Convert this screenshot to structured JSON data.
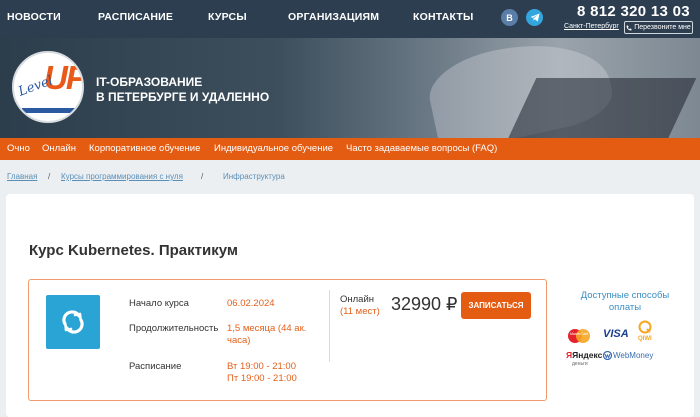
{
  "nav": {
    "items": [
      "НОВОСТИ",
      "РАСПИСАНИЕ",
      "КУРСЫ",
      "ОРГАНИЗАЦИЯМ",
      "КОНТАКТЫ"
    ],
    "vk_label": "В",
    "phone": "8 812 320 13 03",
    "city": "Санкт-Петербург",
    "callback": "Перезвоните мне"
  },
  "hero": {
    "logo_up": "UP",
    "logo_level": "Level",
    "title_line1": "IT-ОБРАЗОВАНИЕ",
    "title_line2": "В ПЕТЕРБУРГЕ И УДАЛЕННО"
  },
  "menu": {
    "items": [
      "Очно",
      "Онлайн",
      "Корпоративное обучение",
      "Индивидуальное обучение",
      "Часто задаваемые вопросы (FAQ)"
    ]
  },
  "breadcrumb": {
    "home": "Главная",
    "sep": "/",
    "courses": "Курсы программирования с нуля",
    "current": "Инфраструктура"
  },
  "course": {
    "title": "Курс Kubernetes. Практикум",
    "start_label": "Начало курса",
    "start_value": "06.02.2024",
    "duration_label": "Продолжительность",
    "duration_value": "1,5 месяца (44 ак. часа)",
    "schedule_label": "Расписание",
    "schedule_line1": "Вт 19:00 - 21:00",
    "schedule_line2": "Пт 19:00 - 21:00",
    "format_label": "Онлайн",
    "seats": "(11 мест)",
    "price": "32990 ₽",
    "enroll": "ЗАПИСАТЬСЯ"
  },
  "payment": {
    "title": "Доступные способы оплаты",
    "methods": [
      "MasterCard",
      "VISA",
      "QIWI",
      "Яндекс",
      "деньги",
      "WebMoney"
    ]
  },
  "colors": {
    "nav_bg": "#2c3e50",
    "accent_orange": "#e45b12",
    "icon_blue": "#2aa4d4"
  }
}
